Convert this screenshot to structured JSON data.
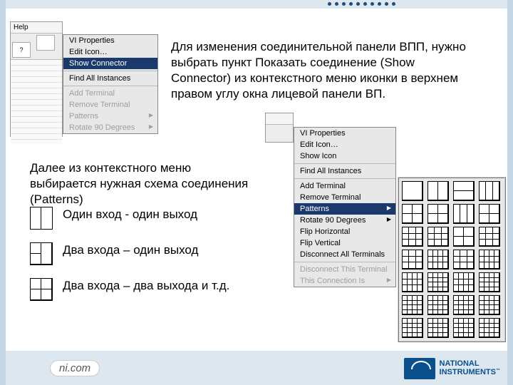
{
  "para1": "Для изменения соединительной панели ВПП, нужно выбрать пункт Показать соединение (Show Connector) из контекстного меню иконки в верхнем правом углу окна лицевой панели ВП.",
  "para2": "Далее из контекстного меню выбирается нужная схема соединения (Patterns)",
  "menu1": {
    "vi_properties": "VI Properties",
    "edit_icon": "Edit Icon…",
    "show_connector": "Show Connector",
    "find_all": "Find All Instances",
    "add_terminal": "Add Terminal",
    "remove_terminal": "Remove Terminal",
    "patterns": "Patterns",
    "rotate": "Rotate 90 Degrees"
  },
  "menu2": {
    "vi_properties": "VI Properties",
    "edit_icon": "Edit Icon…",
    "show_icon": "Show Icon",
    "find_all": "Find All Instances",
    "add_terminal": "Add Terminal",
    "remove_terminal": "Remove Terminal",
    "patterns": "Patterns",
    "rotate": "Rotate 90 Degrees",
    "flip_h": "Flip Horizontal",
    "flip_v": "Flip Vertical",
    "disconnect_all": "Disconnect All Terminals",
    "disconnect_this": "Disconnect This Terminal",
    "this_conn": "This Connection Is"
  },
  "winfrag": {
    "help": "Help"
  },
  "patterns": {
    "r1": "Один вход - один выход",
    "r2": "Два входа – один выход",
    "r3": "Два входа – два выхода и т.д."
  },
  "footer": {
    "ni_com": "ni.com",
    "brand1": "NATIONAL",
    "brand2": "INSTRUMENTS"
  }
}
